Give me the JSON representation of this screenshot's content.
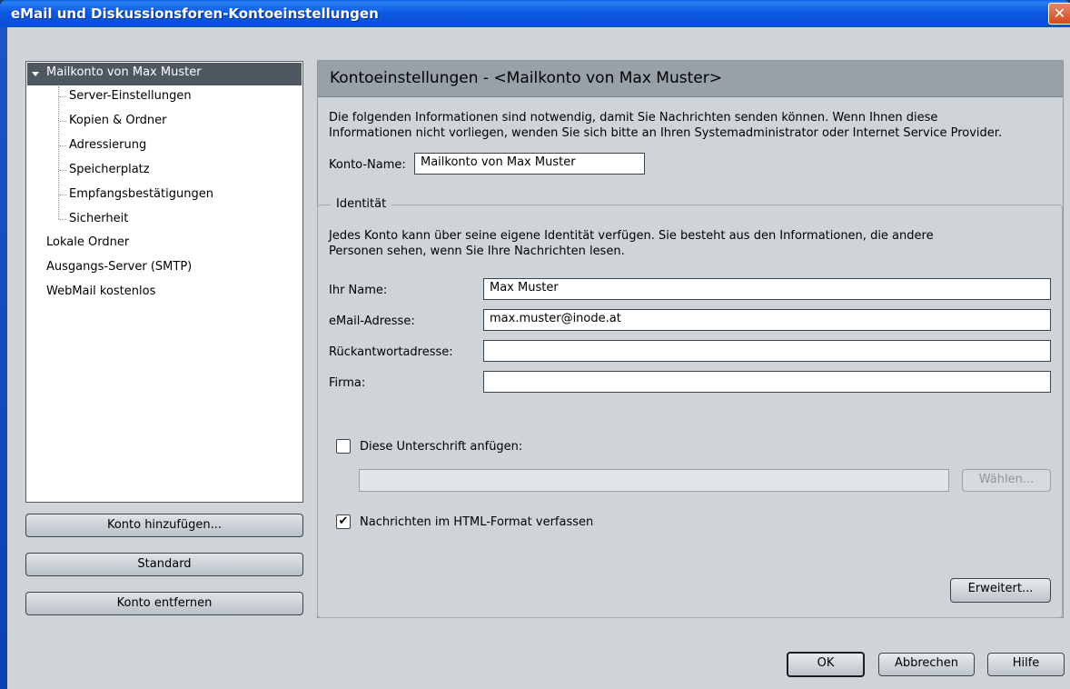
{
  "window": {
    "title": "eMail und Diskussionsforen-Kontoeinstellungen",
    "close_glyph": "✕"
  },
  "tree": {
    "account": "Mailkonto von Max Muster",
    "children": [
      "Server-Einstellungen",
      "Kopien & Ordner",
      "Adressierung",
      "Speicherplatz",
      "Empfangsbestätigungen",
      "Sicherheit"
    ],
    "other": [
      "Lokale Ordner",
      "Ausgangs-Server (SMTP)",
      "WebMail kostenlos"
    ]
  },
  "left_buttons": {
    "add": "Konto hinzufügen...",
    "default": "Standard",
    "remove": "Konto entfernen"
  },
  "panel": {
    "header": "Kontoeinstellungen - <Mailkonto von Max Muster>",
    "intro_line1": "Die folgenden Informationen sind notwendig, damit Sie Nachrichten senden können. Wenn Ihnen diese",
    "intro_line2": "Informationen nicht vorliegen, wenden Sie sich bitte an Ihren Systemadministrator oder Internet Service Provider.",
    "account_name_label": "Konto-Name:",
    "account_name_value": "Mailkonto von Max Muster"
  },
  "identity": {
    "group_label": "Identität",
    "desc_line1": "Jedes Konto kann über seine eigene Identität verfügen. Sie besteht aus den Informationen, die andere",
    "desc_line2": "Personen sehen, wenn Sie Ihre Nachrichten lesen.",
    "name_label": "Ihr Name:",
    "name_value": "Max Muster",
    "email_label": "eMail-Adresse:",
    "email_value": "max.muster@inode.at",
    "reply_label": "Rückantwortadresse:",
    "reply_value": "",
    "org_label": "Firma:",
    "org_value": "",
    "signature_label": "Diese Unterschrift anfügen:",
    "signature_checked": false,
    "signature_path": "",
    "choose_button": "Wählen...",
    "html_label": "Nachrichten im HTML-Format verfassen",
    "html_checked": true,
    "html_check_glyph": "✔",
    "advanced_button": "Erweitert..."
  },
  "dialog_buttons": {
    "ok": "OK",
    "cancel": "Abbrechen",
    "help": "Hilfe"
  },
  "colors": {
    "titlebar": "#0a5fe6",
    "background": "#cfd4d9",
    "header": "#98a1a9",
    "tree_selection": "#4f5860"
  }
}
